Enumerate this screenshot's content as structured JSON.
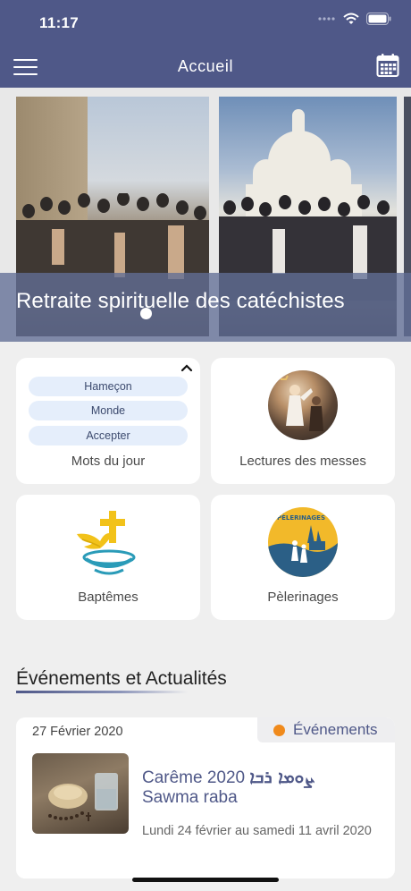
{
  "status_bar": {
    "time": "11:17"
  },
  "nav": {
    "title": "Accueil",
    "menu_icon": "hamburger-menu-icon",
    "calendar_icon": "calendar-icon"
  },
  "hero": {
    "caption": "Retraite spirituelle des catéchistes",
    "active_slide": 1,
    "total_slides": 1
  },
  "grid": {
    "mots": {
      "label": "Mots du jour",
      "words": [
        "Hameçon",
        "Monde",
        "Accepter"
      ]
    },
    "lectures": {
      "label": "Lectures des messes"
    },
    "baptemes": {
      "label": "Baptêmes"
    },
    "pelerinages": {
      "label": "Pèlerinages",
      "logo_text": "PÈLERINAGES"
    }
  },
  "section": {
    "title": "Événements et Actualités"
  },
  "news": [
    {
      "date": "27 Février 2020",
      "tag": "Événements",
      "title_part1": "Carême 2020 ",
      "title_syriac": "ܨܘܡܐ ܪܒܐ",
      "title_part2": "Sawma raba",
      "subtitle": "Lundi 24 février au samedi 11 avril 2020"
    }
  ],
  "colors": {
    "primary": "#4f5888",
    "tag_dot": "#f08a1c",
    "background": "#efefef"
  }
}
